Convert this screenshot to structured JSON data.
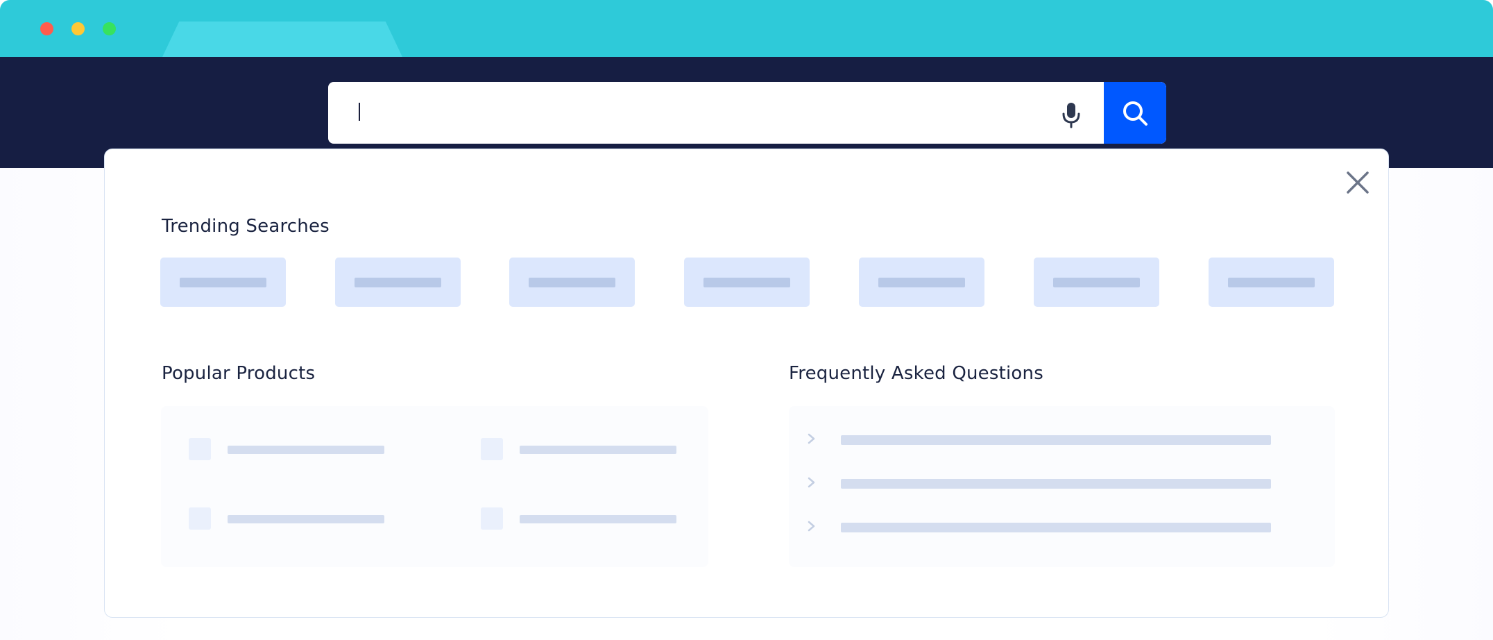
{
  "search": {
    "value": "",
    "placeholder": ""
  },
  "panel": {
    "trending_title": "Trending Searches",
    "popular_title": "Popular Products",
    "faq_title": "Frequently Asked Questions"
  },
  "icons": {
    "search": "search-icon",
    "mic": "microphone-icon",
    "close": "close-icon",
    "chevron": "chevron-right-icon"
  },
  "colors": {
    "titlebar": "#2ecad9",
    "nav": "#161e43",
    "accent": "#0058ff",
    "chip": "#dce7fd"
  }
}
